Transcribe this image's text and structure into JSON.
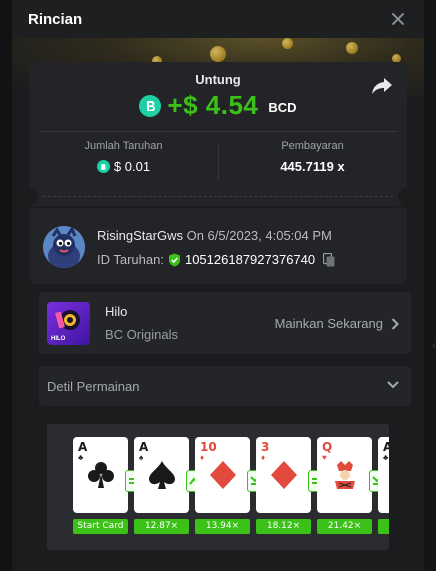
{
  "modal": {
    "title": "Rincian"
  },
  "win": {
    "label": "Untung",
    "amount": "+$ 4.54",
    "currency": "BCD",
    "bet_label": "Jumlah Taruhan",
    "bet_amount": "$ 0.01",
    "payout_label": "Pembayaran",
    "payout_value": "445.7119 x"
  },
  "bet": {
    "username": "RisingStarGws",
    "date": "On 6/5/2023, 4:05:04 PM",
    "id_label": "ID Taruhan:",
    "id_value": "105126187927376740"
  },
  "game": {
    "name": "Hilo",
    "provider": "BC Originals",
    "play_label": "Mainkan Sekarang",
    "thumb_text": "HILO"
  },
  "details": {
    "title": "Detil Permainan"
  },
  "rounds": [
    {
      "rank": "A",
      "suit": "club",
      "color": "black",
      "multiplier": "Start Card",
      "guess": "equal"
    },
    {
      "rank": "A",
      "suit": "spade",
      "color": "black",
      "multiplier": "12.87×",
      "guess": "up"
    },
    {
      "rank": "10",
      "suit": "diamond",
      "color": "red",
      "multiplier": "13.94×",
      "guess": "down"
    },
    {
      "rank": "3",
      "suit": "diamond",
      "color": "red",
      "multiplier": "18.12×",
      "guess": "equal"
    },
    {
      "rank": "Q",
      "suit": "heart-face",
      "color": "red",
      "multiplier": "21.42×",
      "guess": "down"
    },
    {
      "rank": "A",
      "suit": "club",
      "color": "black",
      "multiplier": "",
      "guess": ""
    }
  ],
  "colors": {
    "accent_green": "#3bc117",
    "bcd_teal": "#1ed0a6",
    "card_red": "#e14a3c"
  },
  "icons": [
    "close-icon",
    "share-icon",
    "bcd-coin-icon",
    "shield-check-icon",
    "copy-icon",
    "chevron-right-icon",
    "chevron-down-icon"
  ]
}
